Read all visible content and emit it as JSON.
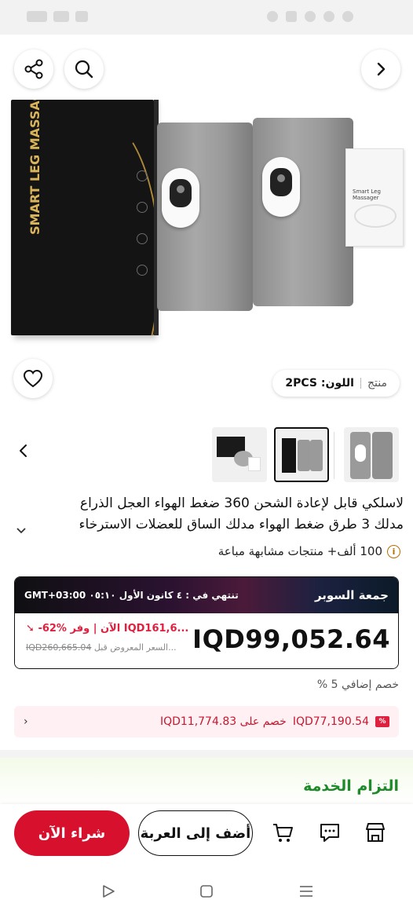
{
  "product": {
    "variant_label": "منتج",
    "color_value": "اللون: 2PCS",
    "title_line1": "لاسلكي قابل لإعادة الشحن 360 ضغط الهواء العجل الذراع",
    "title_line2": "مدلك 3 طرق ضغط الهواء مدلك الساق للعضلات الاسترخاء",
    "similar_sold": "100 ألف+ منتجات مشابهة مباعة",
    "box_text": "SMART LEG MASSAGER",
    "manual_text": "Smart Leg Massager"
  },
  "deal": {
    "title": "جمعة السوبر",
    "ends": "تنتهي في : ٤ كانون الأول ٠٥:١٠ GMT+03:00",
    "price": "IQD99,052.64",
    "discount_line": "-62%  الآن | وفر IQD161,6...",
    "original_price": "IQD260,665.04",
    "original_label": "السعر المعروض قبل..."
  },
  "extra_discount": "خصم إضافي 5 %",
  "coupon": {
    "badge": "%",
    "price": "IQD77,190.54",
    "text": "خصم على IQD11,774.83"
  },
  "service_title": "التزام الخدمة",
  "actions": {
    "buy_now": "شراء الآن",
    "add_to_cart": "أضف إلى العربة"
  },
  "colors": {
    "accent_red": "#d7102d",
    "service_green": "#1f8a2a",
    "coupon_bg": "#fff1f3"
  },
  "icons": [
    "share-icon",
    "search-icon",
    "chevron-right-icon",
    "heart-icon",
    "chevron-left-icon",
    "chevron-down-icon",
    "info-icon",
    "cart-icon",
    "chat-icon",
    "store-icon",
    "back-nav-icon",
    "home-nav-icon",
    "recents-nav-icon"
  ]
}
